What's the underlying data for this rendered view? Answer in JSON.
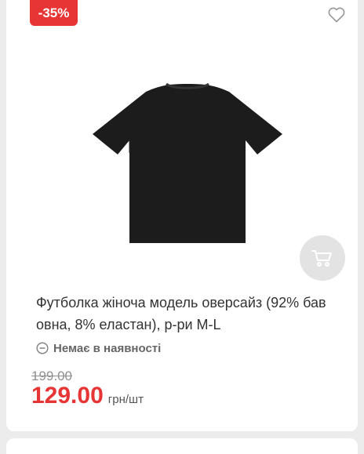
{
  "product": {
    "discount_badge": "-35%",
    "title": "Футболка жіноча модель оверсайз (92% бав овна, 8% еластан), р-ри M-L",
    "availability": "Немає в наявності",
    "old_price": "199.00",
    "price": "129.00",
    "unit": "грн/шт"
  },
  "icons": {
    "wishlist": "heart-icon",
    "cart": "cart-icon",
    "availability": "minus-circle-icon"
  },
  "colors": {
    "accent_red": "#e63534",
    "page_background": "#ececec",
    "cart_button_bg": "#e3e3e3",
    "product_color": "#1c1c1c"
  }
}
